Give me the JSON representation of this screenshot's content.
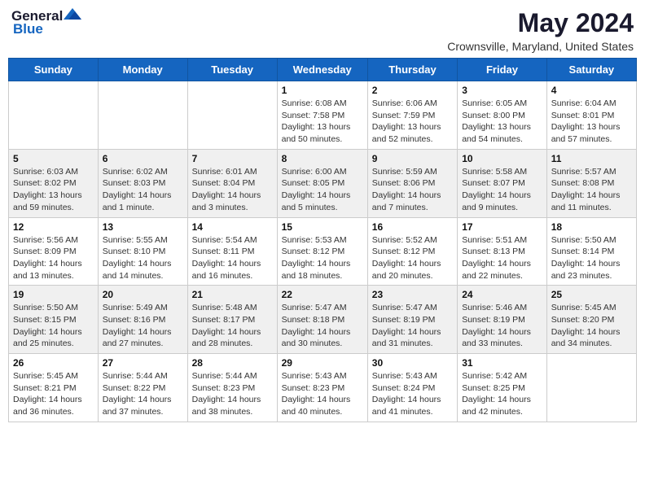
{
  "header": {
    "logo_general": "General",
    "logo_blue": "Blue",
    "main_title": "May 2024",
    "subtitle": "Crownsville, Maryland, United States"
  },
  "weekdays": [
    "Sunday",
    "Monday",
    "Tuesday",
    "Wednesday",
    "Thursday",
    "Friday",
    "Saturday"
  ],
  "rows": [
    [
      {
        "day": "",
        "content": ""
      },
      {
        "day": "",
        "content": ""
      },
      {
        "day": "",
        "content": ""
      },
      {
        "day": "1",
        "content": "Sunrise: 6:08 AM\nSunset: 7:58 PM\nDaylight: 13 hours\nand 50 minutes."
      },
      {
        "day": "2",
        "content": "Sunrise: 6:06 AM\nSunset: 7:59 PM\nDaylight: 13 hours\nand 52 minutes."
      },
      {
        "day": "3",
        "content": "Sunrise: 6:05 AM\nSunset: 8:00 PM\nDaylight: 13 hours\nand 54 minutes."
      },
      {
        "day": "4",
        "content": "Sunrise: 6:04 AM\nSunset: 8:01 PM\nDaylight: 13 hours\nand 57 minutes."
      }
    ],
    [
      {
        "day": "5",
        "content": "Sunrise: 6:03 AM\nSunset: 8:02 PM\nDaylight: 13 hours\nand 59 minutes."
      },
      {
        "day": "6",
        "content": "Sunrise: 6:02 AM\nSunset: 8:03 PM\nDaylight: 14 hours\nand 1 minute."
      },
      {
        "day": "7",
        "content": "Sunrise: 6:01 AM\nSunset: 8:04 PM\nDaylight: 14 hours\nand 3 minutes."
      },
      {
        "day": "8",
        "content": "Sunrise: 6:00 AM\nSunset: 8:05 PM\nDaylight: 14 hours\nand 5 minutes."
      },
      {
        "day": "9",
        "content": "Sunrise: 5:59 AM\nSunset: 8:06 PM\nDaylight: 14 hours\nand 7 minutes."
      },
      {
        "day": "10",
        "content": "Sunrise: 5:58 AM\nSunset: 8:07 PM\nDaylight: 14 hours\nand 9 minutes."
      },
      {
        "day": "11",
        "content": "Sunrise: 5:57 AM\nSunset: 8:08 PM\nDaylight: 14 hours\nand 11 minutes."
      }
    ],
    [
      {
        "day": "12",
        "content": "Sunrise: 5:56 AM\nSunset: 8:09 PM\nDaylight: 14 hours\nand 13 minutes."
      },
      {
        "day": "13",
        "content": "Sunrise: 5:55 AM\nSunset: 8:10 PM\nDaylight: 14 hours\nand 14 minutes."
      },
      {
        "day": "14",
        "content": "Sunrise: 5:54 AM\nSunset: 8:11 PM\nDaylight: 14 hours\nand 16 minutes."
      },
      {
        "day": "15",
        "content": "Sunrise: 5:53 AM\nSunset: 8:12 PM\nDaylight: 14 hours\nand 18 minutes."
      },
      {
        "day": "16",
        "content": "Sunrise: 5:52 AM\nSunset: 8:12 PM\nDaylight: 14 hours\nand 20 minutes."
      },
      {
        "day": "17",
        "content": "Sunrise: 5:51 AM\nSunset: 8:13 PM\nDaylight: 14 hours\nand 22 minutes."
      },
      {
        "day": "18",
        "content": "Sunrise: 5:50 AM\nSunset: 8:14 PM\nDaylight: 14 hours\nand 23 minutes."
      }
    ],
    [
      {
        "day": "19",
        "content": "Sunrise: 5:50 AM\nSunset: 8:15 PM\nDaylight: 14 hours\nand 25 minutes."
      },
      {
        "day": "20",
        "content": "Sunrise: 5:49 AM\nSunset: 8:16 PM\nDaylight: 14 hours\nand 27 minutes."
      },
      {
        "day": "21",
        "content": "Sunrise: 5:48 AM\nSunset: 8:17 PM\nDaylight: 14 hours\nand 28 minutes."
      },
      {
        "day": "22",
        "content": "Sunrise: 5:47 AM\nSunset: 8:18 PM\nDaylight: 14 hours\nand 30 minutes."
      },
      {
        "day": "23",
        "content": "Sunrise: 5:47 AM\nSunset: 8:19 PM\nDaylight: 14 hours\nand 31 minutes."
      },
      {
        "day": "24",
        "content": "Sunrise: 5:46 AM\nSunset: 8:19 PM\nDaylight: 14 hours\nand 33 minutes."
      },
      {
        "day": "25",
        "content": "Sunrise: 5:45 AM\nSunset: 8:20 PM\nDaylight: 14 hours\nand 34 minutes."
      }
    ],
    [
      {
        "day": "26",
        "content": "Sunrise: 5:45 AM\nSunset: 8:21 PM\nDaylight: 14 hours\nand 36 minutes."
      },
      {
        "day": "27",
        "content": "Sunrise: 5:44 AM\nSunset: 8:22 PM\nDaylight: 14 hours\nand 37 minutes."
      },
      {
        "day": "28",
        "content": "Sunrise: 5:44 AM\nSunset: 8:23 PM\nDaylight: 14 hours\nand 38 minutes."
      },
      {
        "day": "29",
        "content": "Sunrise: 5:43 AM\nSunset: 8:23 PM\nDaylight: 14 hours\nand 40 minutes."
      },
      {
        "day": "30",
        "content": "Sunrise: 5:43 AM\nSunset: 8:24 PM\nDaylight: 14 hours\nand 41 minutes."
      },
      {
        "day": "31",
        "content": "Sunrise: 5:42 AM\nSunset: 8:25 PM\nDaylight: 14 hours\nand 42 minutes."
      },
      {
        "day": "",
        "content": ""
      }
    ]
  ]
}
